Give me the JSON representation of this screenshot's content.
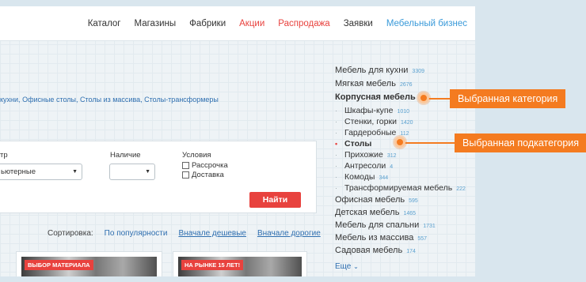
{
  "nav": [
    {
      "label": "Каталог",
      "color": "default"
    },
    {
      "label": "Магазины",
      "color": "default"
    },
    {
      "label": "Фабрики",
      "color": "default"
    },
    {
      "label": "Акции",
      "color": "red"
    },
    {
      "label": "Распродажа",
      "color": "red"
    },
    {
      "label": "Заявки",
      "color": "default"
    },
    {
      "label": "Мебельный бизнес",
      "color": "blue"
    }
  ],
  "crumbs": {
    "items": [
      "кухни",
      "Офисные столы",
      "Столы из массива",
      "Столы-трансформеры"
    ]
  },
  "filter": {
    "col1_label": "тр",
    "col1_value": "ьютерные",
    "col2_label": "Наличие",
    "col2_value": "",
    "col3_label": "Условия",
    "checkbox1": "Рассрочка",
    "checkbox2": "Доставка",
    "find_button": "Найти"
  },
  "sort": {
    "label": "Сортировка:",
    "popular": "По популярности",
    "cheap": "Вначале дешевые",
    "expensive": "Вначале дорогие"
  },
  "cards": [
    {
      "badge": "ВЫБОР МАТЕРИАЛА"
    },
    {
      "badge": "НА РЫНКЕ 15 ЛЕТ!"
    }
  ],
  "categories": {
    "top": [
      {
        "label": "Мебель для кухни",
        "count": "3309"
      },
      {
        "label": "Мягкая мебель",
        "count": "2676"
      },
      {
        "label": "Корпусная мебель",
        "count": ""
      }
    ],
    "sub": [
      {
        "label": "Шкафы-купе",
        "count": "1010"
      },
      {
        "label": "Стенки, горки",
        "count": "1420"
      },
      {
        "label": "Гардеробные",
        "count": "112"
      },
      {
        "label": "Столы",
        "count": ""
      },
      {
        "label": "Прихожие",
        "count": "312"
      },
      {
        "label": "Антресоли",
        "count": "4"
      },
      {
        "label": "Комоды",
        "count": "344"
      },
      {
        "label": "Трансформируемая мебель",
        "count": "222"
      }
    ],
    "bottom": [
      {
        "label": "Офисная мебель",
        "count": "595"
      },
      {
        "label": "Детская мебель",
        "count": "1465"
      },
      {
        "label": "Мебель для спальни",
        "count": "1731"
      },
      {
        "label": "Мебель из массива",
        "count": "557"
      },
      {
        "label": "Садовая мебель",
        "count": "174"
      }
    ],
    "more": "Еще"
  },
  "callouts": {
    "category": "Выбранная категория",
    "subcategory": "Выбранная подкатегория"
  },
  "colors": {
    "accent_red": "#e8423e",
    "link_blue": "#2f6fb0",
    "callout_orange": "#f47b20"
  }
}
